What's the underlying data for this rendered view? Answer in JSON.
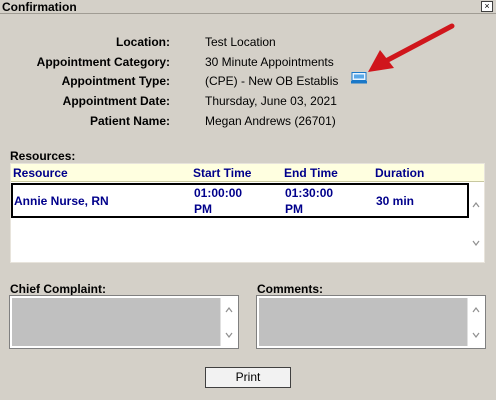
{
  "window": {
    "title": "Confirmation",
    "close_glyph": "×"
  },
  "fields": [
    {
      "label": "Location:",
      "value": "Test Location"
    },
    {
      "label": "Appointment Category:",
      "value": "30 Minute Appointments"
    },
    {
      "label": "Appointment Type:",
      "value": "(CPE) - New OB Establis"
    },
    {
      "label": "Appointment Date:",
      "value": "Thursday, June 03, 2021"
    },
    {
      "label": "Patient Name:",
      "value": "Megan Andrews (26701)"
    }
  ],
  "icons": {
    "appt_type": "monitor-info-icon",
    "annotation": "red-arrow-annotation"
  },
  "colors": {
    "header_text": "#00008b",
    "header_bg": "#ffffe0",
    "annotation": "#d0161c"
  },
  "resources": {
    "label": "Resources:",
    "columns": [
      "Resource",
      "Start Time",
      "End Time",
      "Duration"
    ],
    "rows": [
      {
        "resource": "Annie Nurse, RN",
        "start_line1": "01:00:00",
        "start_line2": "PM",
        "end_line1": "01:30:00",
        "end_line2": "PM",
        "duration": "30 min"
      }
    ]
  },
  "chief_complaint": {
    "label": "Chief Complaint:"
  },
  "comments": {
    "label": "Comments:"
  },
  "print_button": {
    "label": "Print"
  }
}
